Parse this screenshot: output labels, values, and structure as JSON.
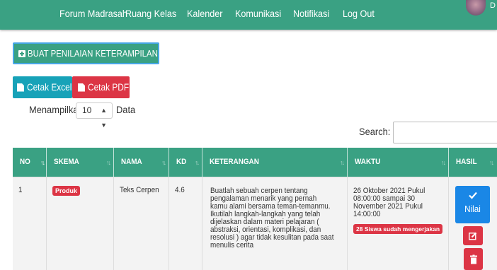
{
  "nav": {
    "items": [
      "Forum Madrasah",
      "Ruang Kelas",
      "Kalender",
      "Komunikasi",
      "Notifikasi",
      "Log Out"
    ],
    "user_name_fragment": "D"
  },
  "actions": {
    "create_label": "BUAT PENILAIAN KETERAMPILAN",
    "excel_label": "Cetak Excel",
    "pdf_label": "Cetak PDF"
  },
  "length_control": {
    "prefix": "Menampilkan",
    "value": "10",
    "suffix": "Data"
  },
  "search": {
    "label": "Search:",
    "value": ""
  },
  "table": {
    "headers": [
      "NO",
      "SKEMA",
      "NAMA",
      "KD",
      "KETERANGAN",
      "WAKTU",
      "HASIL"
    ],
    "rows": [
      {
        "no": "1",
        "skema": "Produk",
        "nama": "Teks Cerpen",
        "kd": "4.6",
        "keterangan": "Buatlah sebuah cerpen tentang pengalaman menarik yang pernah kamu alami bersama teman-temanmu. Ikutilah langkah-langkah yang telah dijelaskan dalam materi pelajaran ( abstraksi, orientasi, komplikasi, dan resolusi ) agar tidak kesulitan pada saat menulis cerita",
        "waktu": "26 Oktober 2021 Pukul 08:00:00 sampai 30 November 2021 Pukul 14:00:00",
        "status_badge": "28 Siswa sudah mengerjakan",
        "nilai_label": "Nilai"
      }
    ]
  },
  "icons": {
    "create": "plus-square-icon",
    "excel": "file-icon",
    "pdf": "file-icon",
    "nilai": "check-icon",
    "edit": "edit-icon",
    "delete": "trash-icon"
  },
  "colors": {
    "primary_green": "#3aa183",
    "info": "#17a2b8",
    "danger": "#dc3545",
    "blue": "#1a87e6"
  }
}
